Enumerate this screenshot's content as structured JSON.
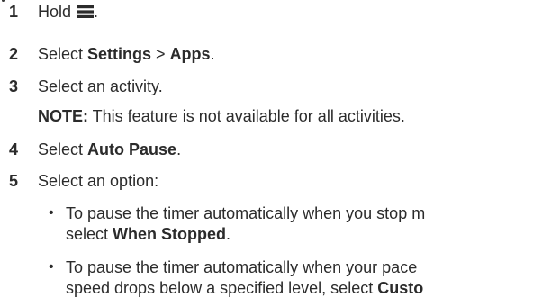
{
  "steps": [
    {
      "num": "1",
      "pre": "Hold ",
      "icon": "menu-icon",
      "post": "."
    },
    {
      "num": "2",
      "pre": "Select ",
      "b1": "Settings",
      "mid": " > ",
      "b2": "Apps",
      "post": "."
    },
    {
      "num": "3",
      "text": "Select an activity."
    },
    {
      "num": "4",
      "pre": "Select ",
      "b1": "Auto Pause",
      "post": "."
    },
    {
      "num": "5",
      "text": "Select an option:"
    }
  ],
  "note": {
    "label": "NOTE:",
    "text": " This feature is not available for all activities."
  },
  "bullets": [
    {
      "dot": "•",
      "line1": "To pause the timer automatically when you stop m",
      "line2_pre": "select ",
      "line2_b": "When Stopped",
      "line2_post": "."
    },
    {
      "dot": "•",
      "line1": "To pause the timer automatically when your pace",
      "line2_pre": "speed drops below a specified level, select ",
      "line2_b": "Custo"
    }
  ]
}
